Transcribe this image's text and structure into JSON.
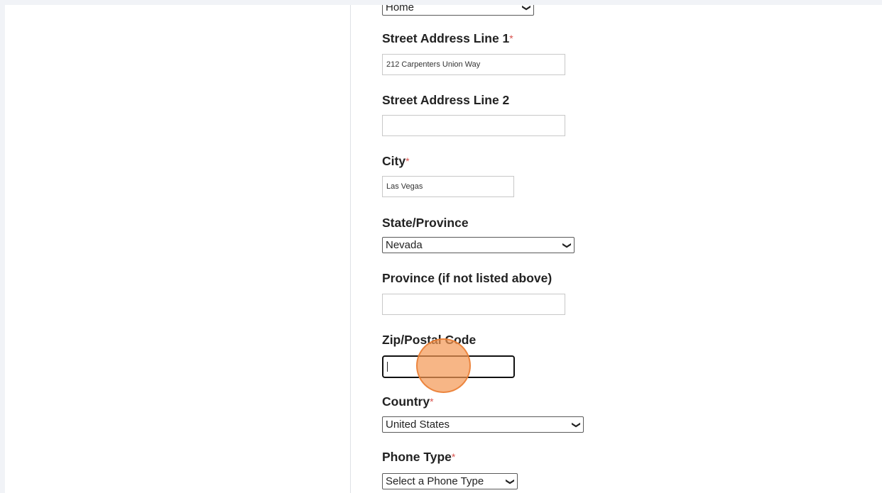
{
  "form": {
    "address_type": {
      "value": "Home"
    },
    "street1": {
      "label": "Street Address Line 1",
      "required_mark": "*",
      "value": "212 Carpenters Union Way"
    },
    "street2": {
      "label": "Street Address Line 2",
      "value": ""
    },
    "city": {
      "label": "City",
      "required_mark": "*",
      "value": "Las Vegas"
    },
    "state": {
      "label": "State/Province",
      "value": "Nevada"
    },
    "province_other": {
      "label": "Province (if not listed above)",
      "value": ""
    },
    "zip": {
      "label": "Zip/Postal Code",
      "value": ""
    },
    "country": {
      "label": "Country",
      "required_mark": "*",
      "value": "United States"
    },
    "phone_type": {
      "label": "Phone Type",
      "required_mark": "*",
      "value": "Select a Phone Type"
    }
  },
  "icons": {
    "dropdown": "chevron-down-icon"
  },
  "colors": {
    "required": "#d9534f",
    "click_marker": "#f4975280",
    "background": "#f1f3f7"
  }
}
